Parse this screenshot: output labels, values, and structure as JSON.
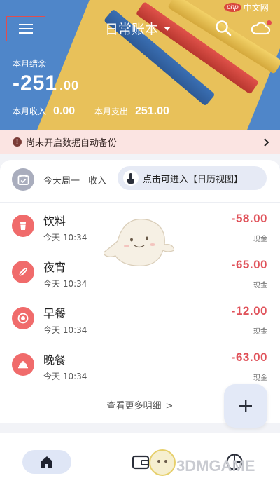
{
  "header": {
    "menu_icon": "hamburger-menu-icon",
    "book_title": "日常账本",
    "search_icon": "search-icon",
    "cloud_icon": "cloud-sync-icon",
    "balance_label": "本月结余",
    "balance_integer": "-251",
    "balance_decimal": ".00",
    "income_label": "本月收入",
    "income_value": "0.00",
    "expense_label": "本月支出",
    "expense_value": "251.00"
  },
  "backup_banner": {
    "text": "尚未开启数据自动备份",
    "info_icon": "!"
  },
  "day_summary": {
    "day_text": "今天周一",
    "income_text": "收入",
    "tooltip_text": "点击可进入【日历视图】"
  },
  "transactions": [
    {
      "category": "饮料",
      "time": "今天 10:34",
      "amount": "-58.00",
      "method": "现金",
      "icon": "drink-cup-icon"
    },
    {
      "category": "夜宵",
      "time": "今天 10:34",
      "amount": "-65.00",
      "method": "现金",
      "icon": "food-icon"
    },
    {
      "category": "早餐",
      "time": "今天 10:34",
      "amount": "-12.00",
      "method": "现金",
      "icon": "plate-icon"
    },
    {
      "category": "晚餐",
      "time": "今天 10:34",
      "amount": "-63.00",
      "method": "现金",
      "icon": "cloche-icon"
    }
  ],
  "more_link": "查看更多明细",
  "more_arrow": ">",
  "fab_icon": "plus-icon",
  "bottom_nav": {
    "home_icon": "home-icon",
    "wallet_icon": "wallet-icon",
    "chart_icon": "pie-chart-icon"
  },
  "watermarks": {
    "top_php": "php",
    "top_text": "中文网",
    "bottom": "3DMGAME"
  },
  "colors": {
    "header_blue": "#4f86c9",
    "expense_red": "#e0525a",
    "category_red": "#f06b6b",
    "banner_pink": "#fbe4e2"
  }
}
